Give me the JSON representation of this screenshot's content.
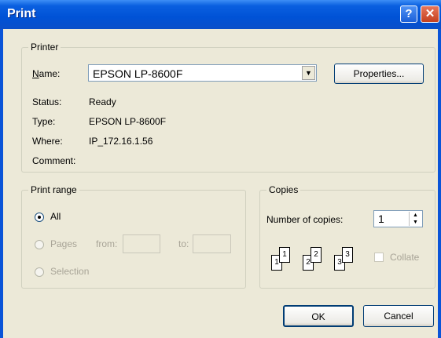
{
  "window": {
    "title": "Print"
  },
  "titlebar": {
    "help_label": "?",
    "close_label": "✕"
  },
  "printer": {
    "group_label": "Printer",
    "name_label": "Name:",
    "name_value": "EPSON LP-8600F",
    "properties_label": "Properties...",
    "status_label": "Status:",
    "status_value": "Ready",
    "type_label": "Type:",
    "type_value": "EPSON LP-8600F",
    "where_label": "Where:",
    "where_value": "IP_172.16.1.56",
    "comment_label": "Comment:",
    "comment_value": ""
  },
  "print_range": {
    "group_label": "Print range",
    "all_label": "All",
    "pages_label": "Pages",
    "from_label": "from:",
    "to_label": "to:",
    "selection_label": "Selection",
    "selected": "all"
  },
  "copies": {
    "group_label": "Copies",
    "number_label": "Number of copies:",
    "number_value": "1",
    "collate_label": "Collate",
    "collate_checked": false,
    "page_icon_numbers": [
      "1",
      "1",
      "2",
      "2",
      "3",
      "3"
    ]
  },
  "buttons": {
    "ok": "OK",
    "cancel": "Cancel"
  },
  "icons": {
    "help": "help-icon",
    "close": "close-icon",
    "dropdown": "chevron-down-icon",
    "spin": "spin-arrows-icon",
    "collate": "collate-pages-icon"
  }
}
